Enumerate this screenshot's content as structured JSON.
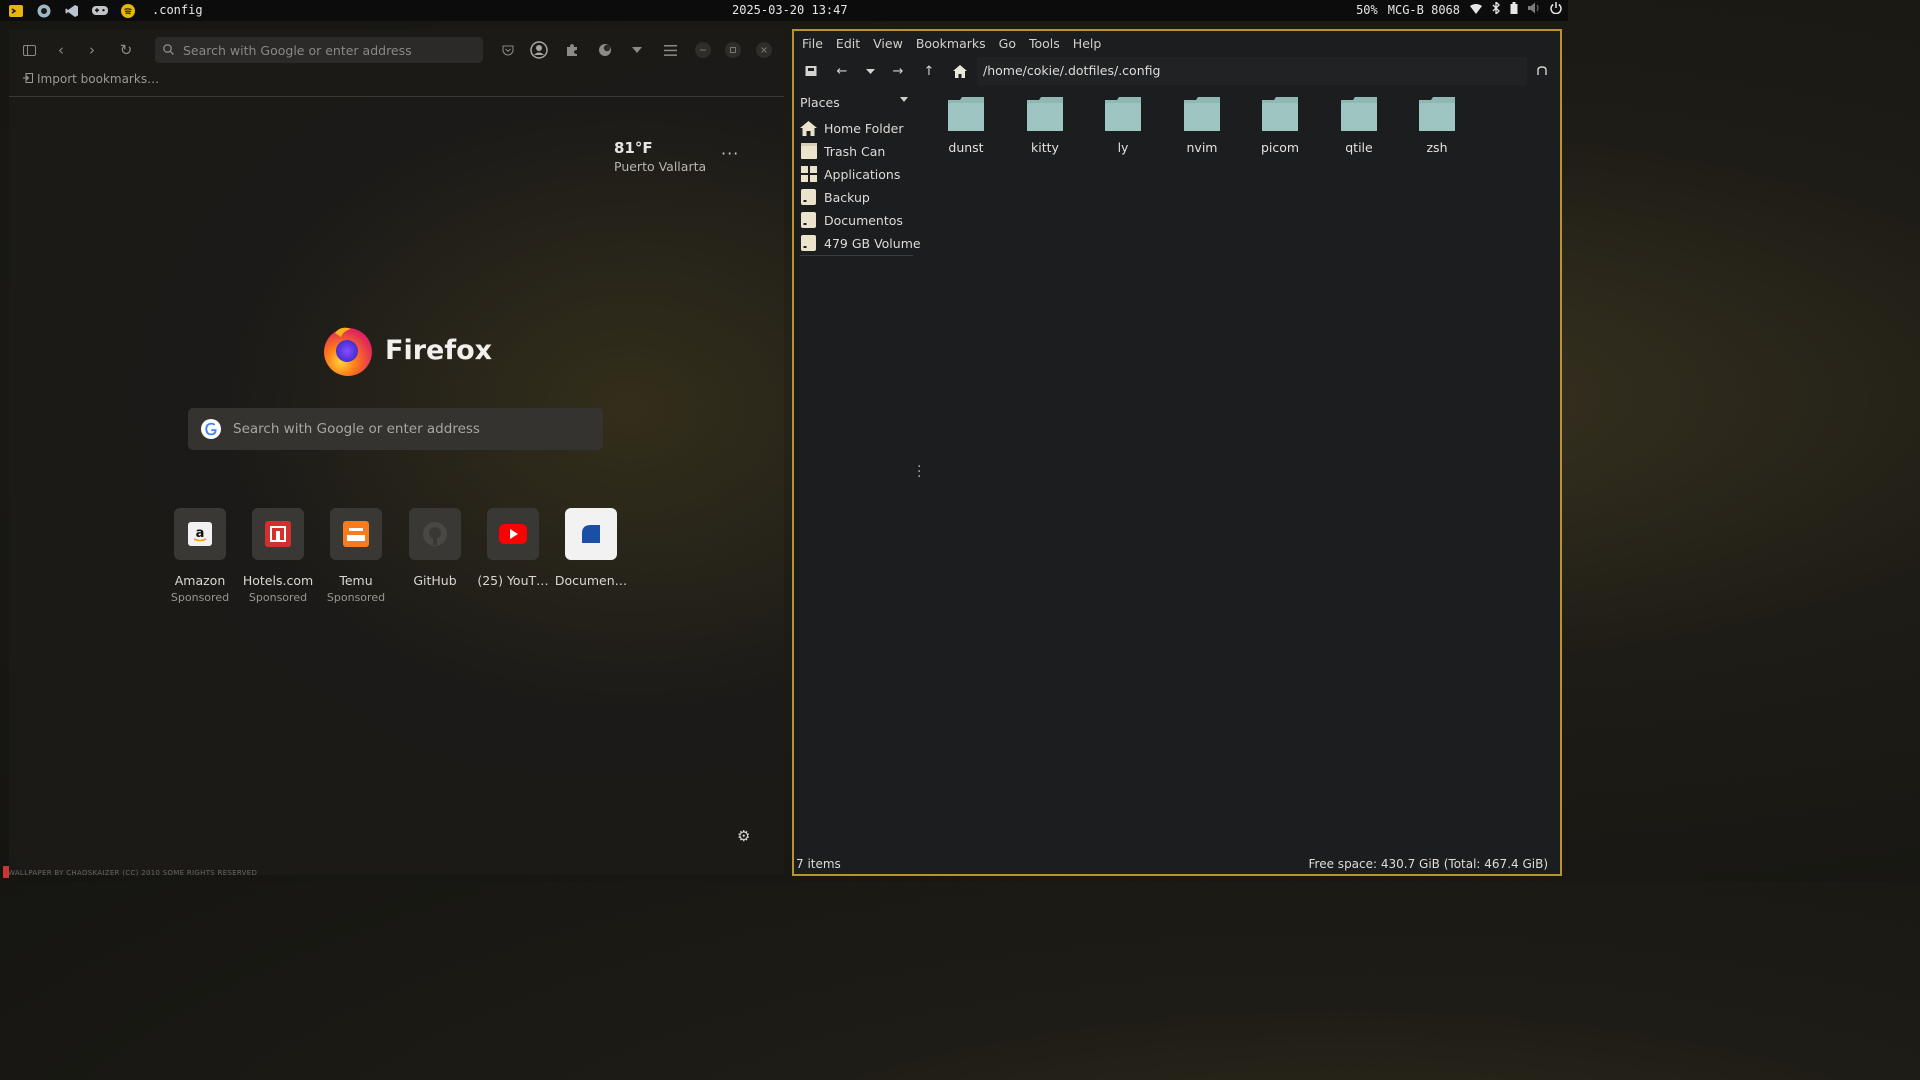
{
  "topbar": {
    "window_title": ".config",
    "clock": "2025-03-20 13:47",
    "battery": "50%",
    "network": "MCG-B 8068",
    "icons": [
      "terminal-icon",
      "browser-icon",
      "vscode-icon",
      "gamepad-icon",
      "spotify-icon",
      "wifi-icon",
      "bluetooth-icon",
      "battery-icon",
      "volume-icon",
      "power-icon"
    ]
  },
  "firefox": {
    "urlbar_placeholder": "Search with Google or enter address",
    "import_bookmarks": "Import bookmarks…",
    "weather": {
      "temp": "81°F",
      "city": "Puerto Vallarta",
      "menu": "···"
    },
    "brand": "Firefox",
    "search_placeholder": "Search with Google or enter address",
    "tiles": [
      {
        "name": "Amazon",
        "sponsored": "Sponsored"
      },
      {
        "name": "Hotels.com",
        "sponsored": "Sponsored"
      },
      {
        "name": "Temu",
        "sponsored": "Sponsored"
      },
      {
        "name": "GitHub",
        "sponsored": ""
      },
      {
        "name": "(25) YouT…",
        "sponsored": ""
      },
      {
        "name": "Documen…",
        "sponsored": ""
      }
    ]
  },
  "filemanager": {
    "menu": [
      "File",
      "Edit",
      "View",
      "Bookmarks",
      "Go",
      "Tools",
      "Help"
    ],
    "path": "/home/cokie/.dotfiles/.config",
    "places_title": "Places",
    "places": [
      "Home Folder",
      "Trash Can",
      "Applications",
      "Backup",
      "Documentos",
      "479 GB Volume"
    ],
    "folders": [
      "dunst",
      "kitty",
      "ly",
      "nvim",
      "picom",
      "qtile",
      "zsh"
    ],
    "status_count": "7 items",
    "status_free": "Free space: 430.7 GiB (Total: 467.4 GiB)"
  },
  "credit": "WALLPAPER BY CHAOSKAIZER (CC) 2010  SOME RIGHTS RESERVED",
  "colors": {
    "folder": "#8fb7b4",
    "accent_border": "#b8932f",
    "topbar_bg": "#0c0c0c"
  }
}
